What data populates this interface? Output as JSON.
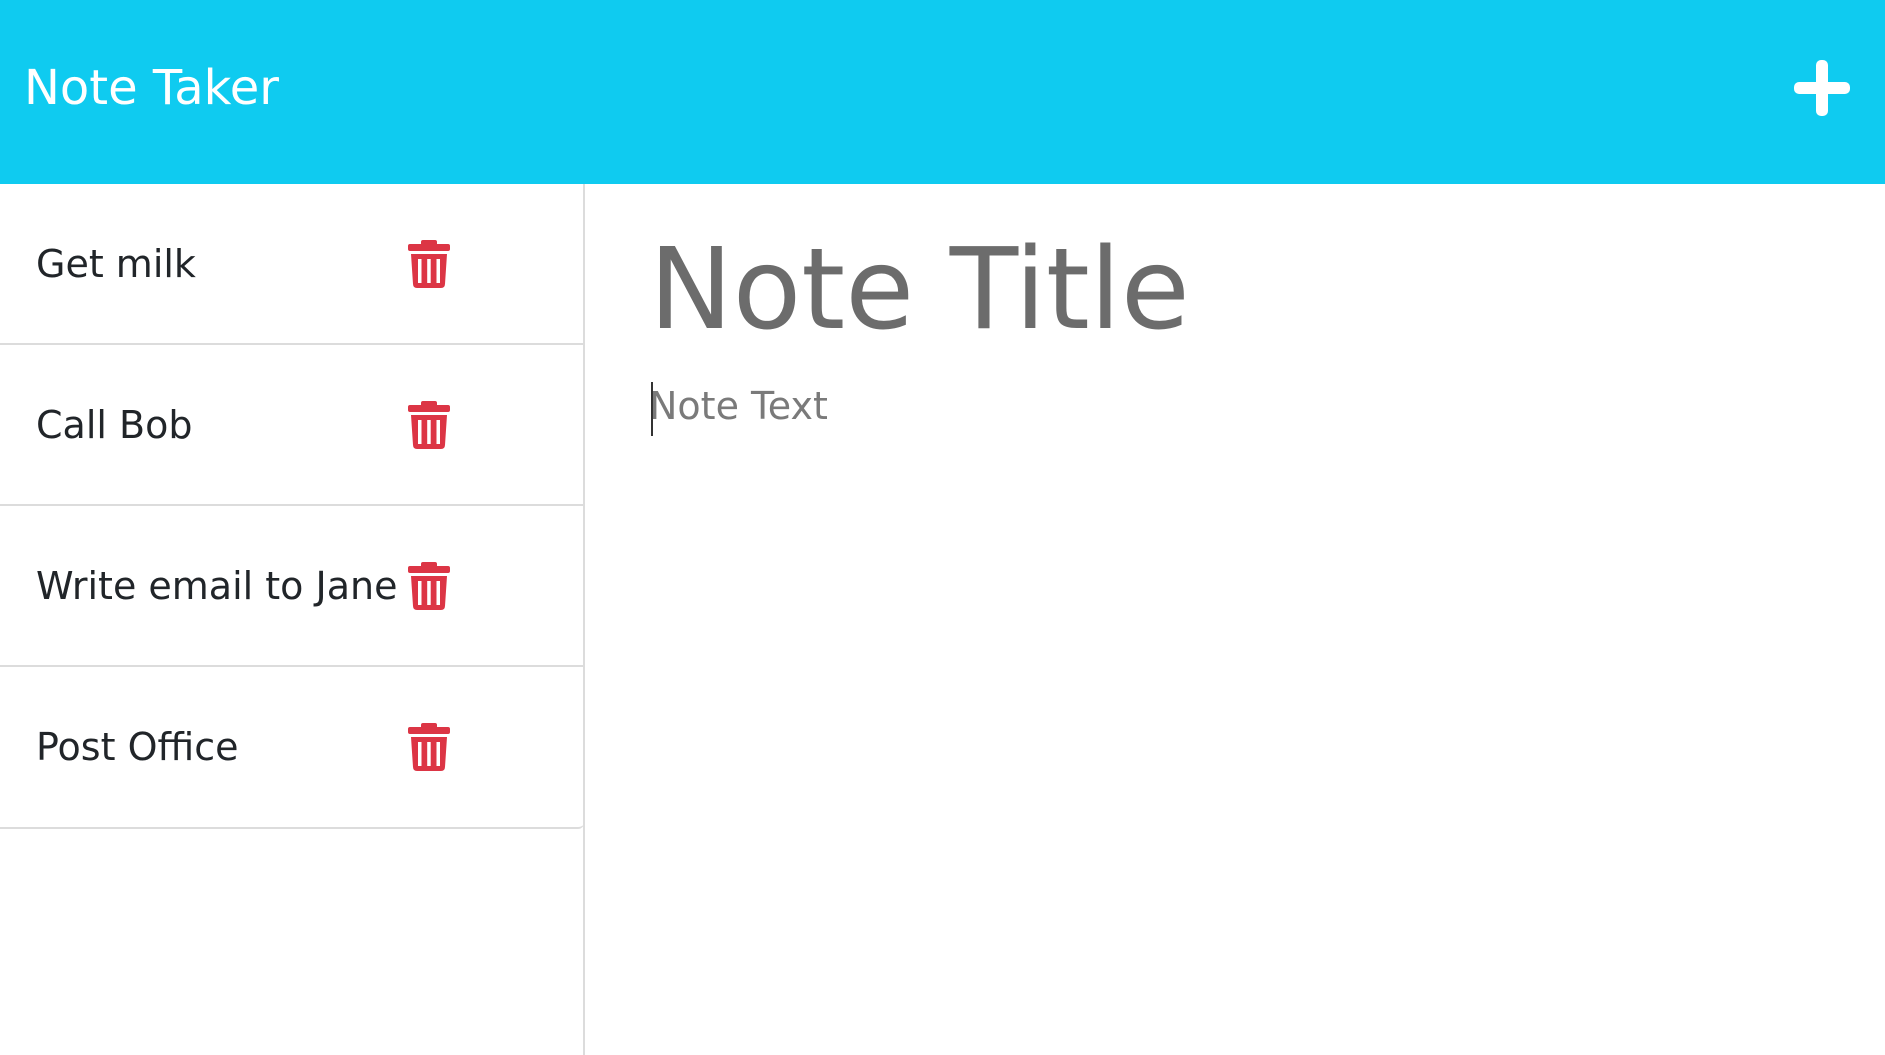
{
  "navbar": {
    "brand": "Note Taker",
    "new_note_icon": "plus-icon",
    "background": "#0fcbf0"
  },
  "sidebar": {
    "delete_icon": "trash-icon",
    "delete_color": "#dc3545",
    "notes": [
      {
        "title": "Get milk"
      },
      {
        "title": "Call Bob"
      },
      {
        "title": "Write email to Jane"
      },
      {
        "title": "Post Office"
      }
    ]
  },
  "editor": {
    "title_placeholder": "Note Title",
    "title_value": "",
    "text_placeholder": "Note Text",
    "text_value": ""
  }
}
